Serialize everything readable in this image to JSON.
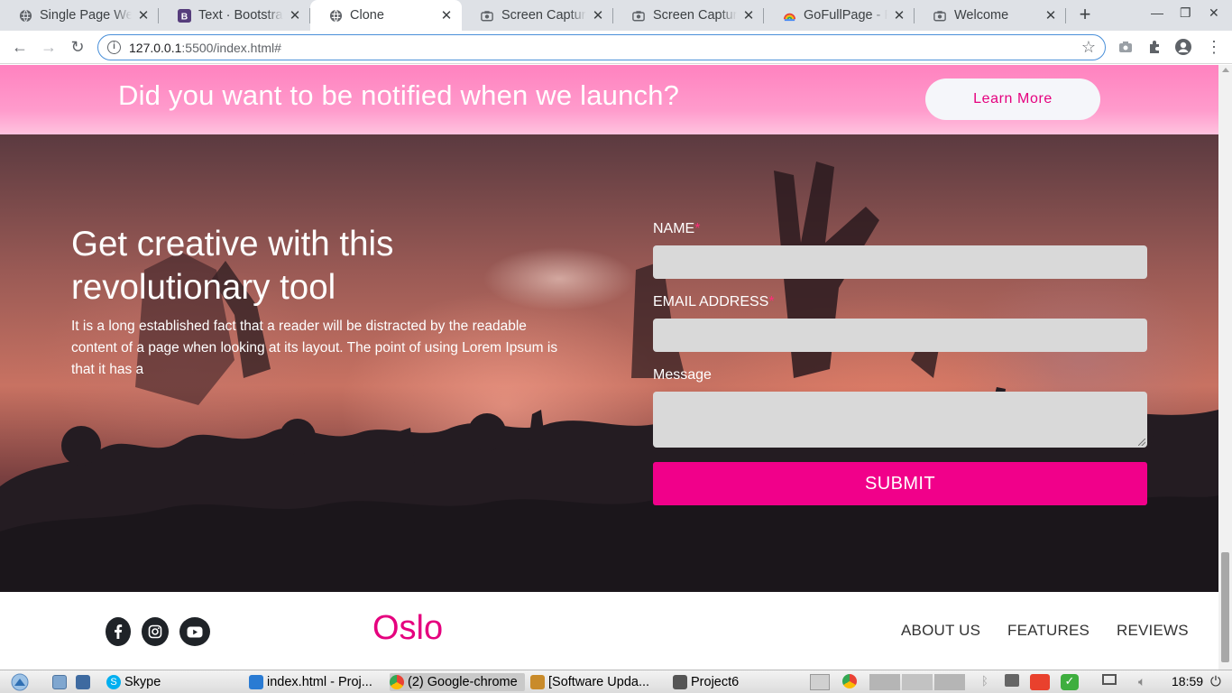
{
  "browser": {
    "tabs": [
      {
        "title": "Single Page Website",
        "icon": "globe-icon",
        "active": false
      },
      {
        "title": "Text · Bootstrap",
        "icon": "bootstrap-icon",
        "active": false
      },
      {
        "title": "Clone",
        "icon": "globe-icon",
        "active": true
      },
      {
        "title": "Screen Capture",
        "icon": "camera-icon",
        "active": false
      },
      {
        "title": "Screen Capture",
        "icon": "camera-icon",
        "active": false
      },
      {
        "title": "GoFullPage - Full",
        "icon": "gofullpage-icon",
        "active": false
      },
      {
        "title": "Welcome",
        "icon": "camera-icon",
        "active": false
      }
    ],
    "url_host": "127.0.0.1",
    "url_rest": ":5500/index.html#"
  },
  "notify": {
    "heading": "Did you want to be notified when we launch?",
    "button": "Learn More"
  },
  "hero": {
    "title": "Get creative with this revolutionary tool",
    "body": "It is a long established fact that a reader will be distracted by the readable content of a page when looking at its layout. The point of using Lorem Ipsum is that it has a"
  },
  "form": {
    "name_label": "NAME",
    "email_label": "EMAIL ADDRESS",
    "message_label": "Message",
    "required_mark": "*",
    "submit": "SUBMIT"
  },
  "footer": {
    "brand": "Oslo",
    "social": [
      "facebook-icon",
      "instagram-icon",
      "youtube-icon"
    ],
    "nav": [
      "ABOUT US",
      "FEATURES",
      "REVIEWS"
    ]
  },
  "taskbar": {
    "items": [
      "Skype",
      "index.html - Proj...",
      "(2) Google-chrome",
      "[Software Upda...",
      "Project6"
    ],
    "clock": "18:59"
  },
  "colors": {
    "accent": "#f1008a",
    "brand": "#e5007e",
    "banner": "#ff8fc5"
  }
}
